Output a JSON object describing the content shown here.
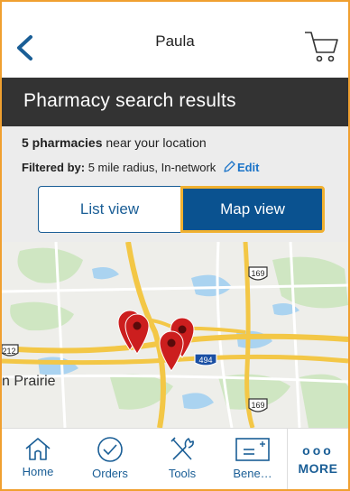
{
  "header": {
    "user_name": "Paula"
  },
  "banner": {
    "title": "Pharmacy search results"
  },
  "results": {
    "count_bold": "5 pharmacies",
    "count_rest": " near your location",
    "filter_label": "Filtered by:",
    "filter_value": " 5 mile radius, In-network",
    "edit_label": "Edit"
  },
  "view_toggle": {
    "list_label": "List view",
    "map_label": "Map view",
    "selected": "Map view"
  },
  "map": {
    "place_label": "n Prairie",
    "road_labels": [
      "169",
      "212",
      "494",
      "169"
    ],
    "pin_color": "#cc1e1e"
  },
  "tabbar": {
    "items": [
      {
        "label": "Home",
        "icon": "home-icon"
      },
      {
        "label": "Orders",
        "icon": "check-circle-icon"
      },
      {
        "label": "Tools",
        "icon": "tools-icon"
      },
      {
        "label": "Bene…",
        "icon": "benefits-card-icon"
      }
    ],
    "more_label": "MORE",
    "more_dots": "ooo"
  },
  "colors": {
    "accent": "#1a5e96",
    "banner": "#333333",
    "selected_toggle": "#0a5290",
    "focus": "#f0b030"
  }
}
